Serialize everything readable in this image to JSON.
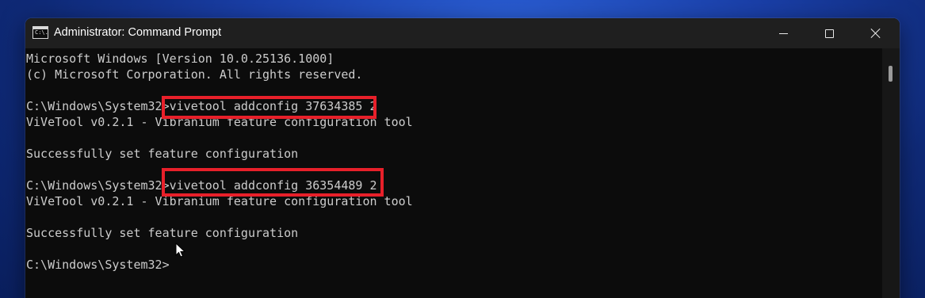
{
  "window": {
    "title": "Administrator: Command Prompt",
    "icon_name": "command-prompt-icon",
    "icon_text": "C:\\."
  },
  "controls": {
    "minimize": "minimize-icon",
    "maximize": "maximize-icon",
    "close": "close-icon"
  },
  "console": {
    "lines": [
      "Microsoft Windows [Version 10.0.25136.1000]",
      "(c) Microsoft Corporation. All rights reserved.",
      "",
      "C:\\Windows\\System32>vivetool addconfig 37634385 2",
      "ViVeTool v0.2.1 - Vibranium feature configuration tool",
      "",
      "Successfully set feature configuration",
      "",
      "C:\\Windows\\System32>vivetool addconfig 36354489 2",
      "ViVeTool v0.2.1 - Vibranium feature configuration tool",
      "",
      "Successfully set feature configuration",
      "",
      "C:\\Windows\\System32>"
    ]
  },
  "colors": {
    "highlight": "#e8202a",
    "console_bg": "#0c0c0c",
    "console_text": "#cccccc",
    "titlebar_bg": "#1f1f1f"
  }
}
